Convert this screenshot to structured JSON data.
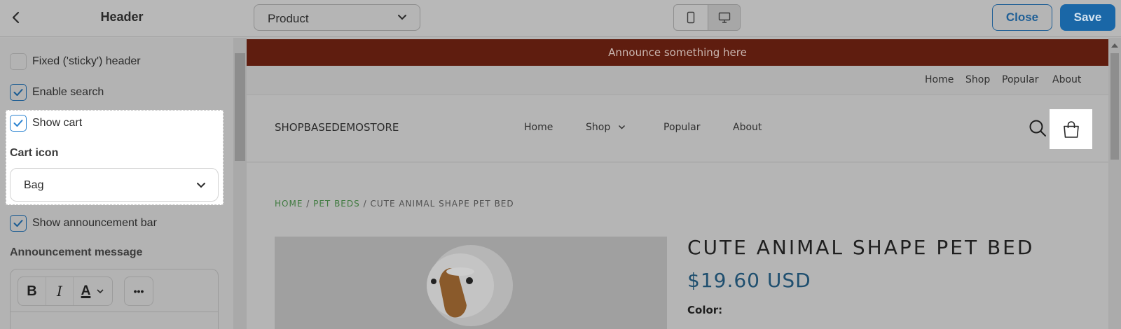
{
  "topbar": {
    "title": "Header",
    "page_select": "Product",
    "close_label": "Close",
    "save_label": "Save",
    "accent": "#1a67a7"
  },
  "settings": {
    "sticky_header": {
      "label": "Fixed ('sticky') header",
      "checked": false
    },
    "enable_search": {
      "label": "Enable search",
      "checked": true
    },
    "show_cart": {
      "label": "Show cart",
      "checked": true
    },
    "cart_icon_label": "Cart icon",
    "cart_icon_value": "Bag",
    "show_announcement": {
      "label": "Show announcement bar",
      "checked": true
    },
    "announcement_label": "Announcement message",
    "rte_buttons": [
      "B",
      "I",
      "A",
      "•••"
    ]
  },
  "preview": {
    "announcement": "Announce something here",
    "announcement_color": "#5f1d0f",
    "top_nav": [
      "Home",
      "Shop",
      "Popular",
      "About"
    ],
    "brand": "SHOPBASEDEMOSTORE",
    "main_nav": [
      "Home",
      "Shop",
      "Popular",
      "About"
    ],
    "breadcrumb": {
      "home": "HOME",
      "sep": "/",
      "category": "PET BEDS",
      "current": "CUTE ANIMAL SHAPE PET BED"
    },
    "product_title": "CUTE ANIMAL SHAPE PET BED",
    "price": "$19.60 USD",
    "color_label": "Color:"
  }
}
